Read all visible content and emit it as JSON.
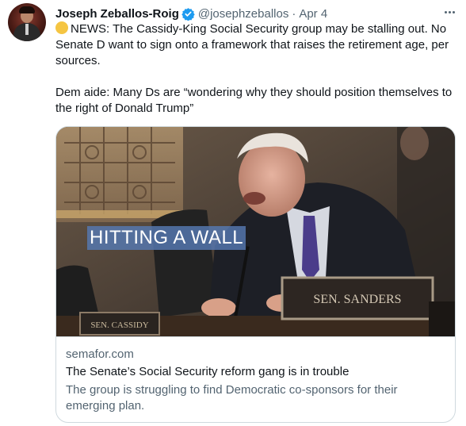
{
  "author": {
    "name": "Joseph Zeballos-Roig",
    "handle": "@josephzeballos",
    "separator": "·",
    "date": "Apr 4"
  },
  "icons": {
    "verified": "verified-badge-icon",
    "more": "more-options-icon",
    "emoji": "yellow-circle-emoji-icon"
  },
  "colors": {
    "verified": "#1d9bf0",
    "secondary_text": "#536471",
    "border": "#cfd9de",
    "overlay": "#5679b2"
  },
  "tweet": {
    "line1": "NEWS: The Cassidy-King Social Security group may be stalling out. No Senate D want to sign onto a framework that raises the retirement age, per sources.",
    "line2": "Dem aide: Many Ds are “wondering why they should position themselves to the right of Donald Trump”"
  },
  "card": {
    "image_overlay": "HITTING A WALL",
    "nameplate_left": "SEN. CASSIDY",
    "nameplate_right": "SEN. SANDERS",
    "domain": "semafor.com",
    "title": "The Senate’s Social Security reform gang is in trouble",
    "description": "The group is struggling to find Democratic co-sponsors for their emerging plan."
  }
}
